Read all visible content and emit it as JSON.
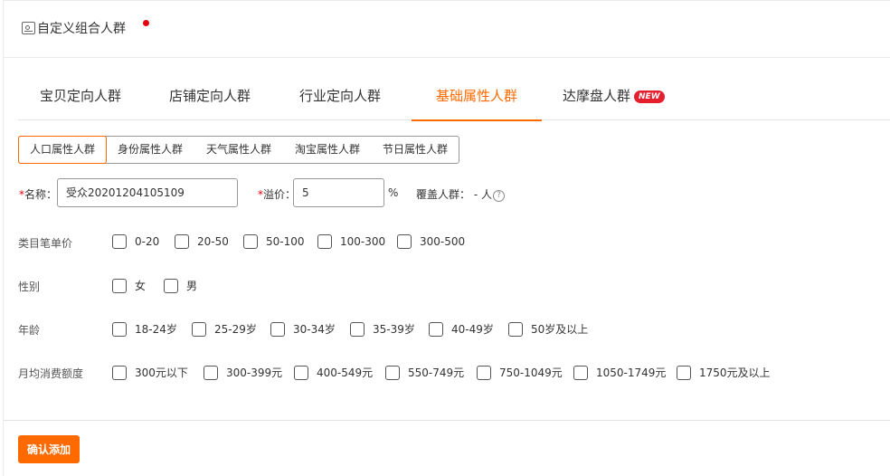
{
  "header": {
    "title": "自定义组合人群",
    "icon": "crowd-card-icon",
    "dot_color": "#e5000e"
  },
  "tabs": [
    {
      "label": "宝贝定向人群",
      "active": false
    },
    {
      "label": "店铺定向人群",
      "active": false
    },
    {
      "label": "行业定向人群",
      "active": false
    },
    {
      "label": "基础属性人群",
      "active": true
    },
    {
      "label": "达摩盘人群",
      "active": false,
      "badge": "NEW"
    }
  ],
  "subtabs": [
    {
      "label": "人口属性人群",
      "active": true
    },
    {
      "label": "身份属性人群",
      "active": false
    },
    {
      "label": "天气属性人群",
      "active": false
    },
    {
      "label": "淘宝属性人群",
      "active": false
    },
    {
      "label": "节日属性人群",
      "active": false
    }
  ],
  "form": {
    "required_mark": "*",
    "name_label": "名称：",
    "name_value": "受众20201204105109",
    "premium_label": "溢价：",
    "premium_value": "5",
    "premium_unit": "%",
    "coverage_label": "覆盖人群：",
    "coverage_value": "- 人",
    "help_icon": "question-circle-icon"
  },
  "filters": [
    {
      "label": "类目笔单价",
      "options": [
        "0-20",
        "20-50",
        "50-100",
        "100-300",
        "300-500"
      ]
    },
    {
      "label": "性别",
      "options": [
        "女",
        "男"
      ]
    },
    {
      "label": "年龄",
      "options": [
        "18-24岁",
        "25-29岁",
        "30-34岁",
        "35-39岁",
        "40-49岁",
        "50岁及以上"
      ]
    },
    {
      "label": "月均消费额度",
      "options": [
        "300元以下",
        "300-399元",
        "400-549元",
        "550-749元",
        "750-1049元",
        "1050-1749元",
        "1750元及以上"
      ]
    }
  ],
  "footer": {
    "confirm_label": "确认添加"
  },
  "colors": {
    "accent": "#ff6a00",
    "badge": "#e5202e"
  }
}
